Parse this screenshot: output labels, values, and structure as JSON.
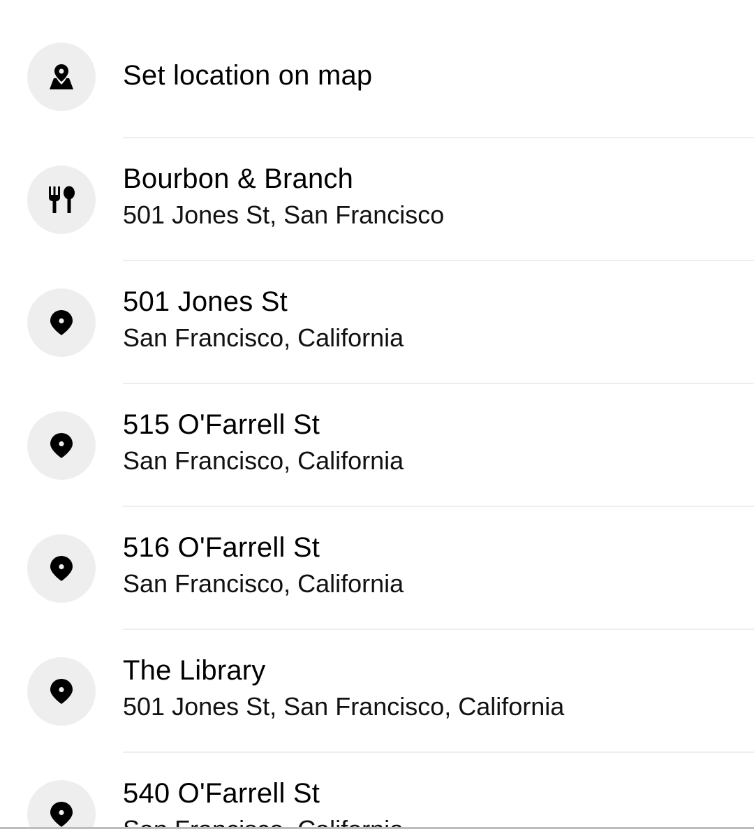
{
  "list": {
    "set_location": {
      "label": "Set location on map",
      "icon": "map-pin-icon"
    },
    "items": [
      {
        "title": "Bourbon & Branch",
        "subtitle": "501 Jones St, San Francisco",
        "icon": "restaurant-icon"
      },
      {
        "title": "501 Jones St",
        "subtitle": "San Francisco, California",
        "icon": "location-pin-icon"
      },
      {
        "title": "515 O'Farrell St",
        "subtitle": "San Francisco, California",
        "icon": "location-pin-icon"
      },
      {
        "title": "516 O'Farrell St",
        "subtitle": "San Francisco, California",
        "icon": "location-pin-icon"
      },
      {
        "title": "The Library",
        "subtitle": "501 Jones St, San Francisco, California",
        "icon": "location-pin-icon"
      },
      {
        "title": "540 O'Farrell St",
        "subtitle": "San Francisco, California",
        "icon": "location-pin-icon"
      }
    ]
  },
  "colors": {
    "icon_background": "#eeeeee",
    "divider": "#eeeeee",
    "text": "#000000"
  }
}
